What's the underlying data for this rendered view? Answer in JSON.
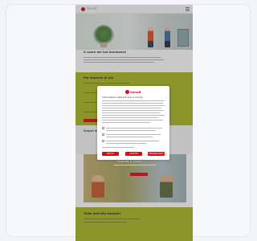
{
  "site": {
    "logo_text": "Sanofi"
  },
  "intro": {
    "title": "Il cuore del tuo benessere"
  },
  "green_section": {
    "title": "Per saperne di più"
  },
  "mid_section": {
    "title": "Scopri di più"
  },
  "video": {
    "title": "Guarda il video"
  },
  "footer_section": {
    "title": "Tutto dall'alto bambini"
  },
  "consent_modal": {
    "logo_text": "Sanofi",
    "title": "Informativa sulla privacy e cookie",
    "buttons": [
      "RIFIUTA",
      "ACCETTA",
      "PERSONALIZZA"
    ]
  },
  "colors": {
    "brand_red": "#e30613",
    "accent_green": "#aab723"
  }
}
